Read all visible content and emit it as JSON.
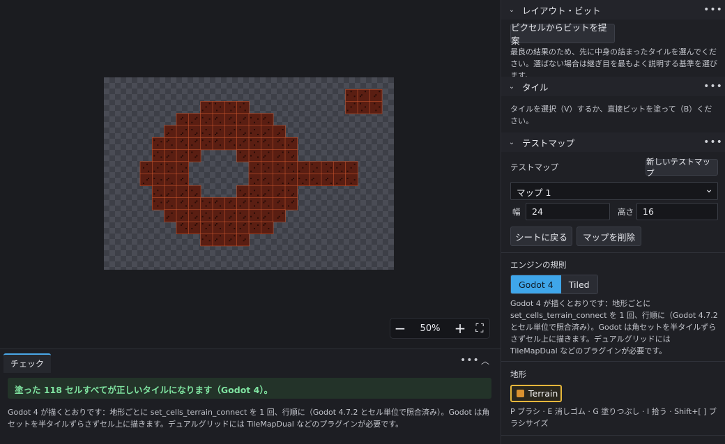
{
  "canvas": {
    "zoom_out_glyph": "−",
    "zoom_level": "50%",
    "zoom_in_glyph": "+",
    "fit_glyph": "⛶",
    "grid": {
      "cols": 24,
      "rows": 16,
      "cells": [
        [
          20,
          1
        ],
        [
          21,
          1
        ],
        [
          22,
          1
        ],
        [
          20,
          2
        ],
        [
          21,
          2
        ],
        [
          22,
          2
        ],
        [
          8,
          2
        ],
        [
          9,
          2
        ],
        [
          10,
          2
        ],
        [
          11,
          2
        ],
        [
          6,
          3
        ],
        [
          7,
          3
        ],
        [
          8,
          3
        ],
        [
          9,
          3
        ],
        [
          10,
          3
        ],
        [
          11,
          3
        ],
        [
          12,
          3
        ],
        [
          13,
          3
        ],
        [
          5,
          4
        ],
        [
          6,
          4
        ],
        [
          7,
          4
        ],
        [
          8,
          4
        ],
        [
          9,
          4
        ],
        [
          10,
          4
        ],
        [
          11,
          4
        ],
        [
          12,
          4
        ],
        [
          13,
          4
        ],
        [
          14,
          4
        ],
        [
          4,
          5
        ],
        [
          5,
          5
        ],
        [
          6,
          5
        ],
        [
          7,
          5
        ],
        [
          8,
          5
        ],
        [
          9,
          5
        ],
        [
          10,
          5
        ],
        [
          11,
          5
        ],
        [
          12,
          5
        ],
        [
          13,
          5
        ],
        [
          14,
          5
        ],
        [
          15,
          5
        ],
        [
          4,
          6
        ],
        [
          5,
          6
        ],
        [
          6,
          6
        ],
        [
          7,
          6
        ],
        [
          11,
          6
        ],
        [
          12,
          6
        ],
        [
          13,
          6
        ],
        [
          14,
          6
        ],
        [
          15,
          6
        ],
        [
          3,
          7
        ],
        [
          4,
          7
        ],
        [
          5,
          7
        ],
        [
          6,
          7
        ],
        [
          12,
          7
        ],
        [
          13,
          7
        ],
        [
          14,
          7
        ],
        [
          15,
          7
        ],
        [
          16,
          7
        ],
        [
          17,
          7
        ],
        [
          18,
          7
        ],
        [
          19,
          7
        ],
        [
          20,
          7
        ],
        [
          3,
          8
        ],
        [
          4,
          8
        ],
        [
          5,
          8
        ],
        [
          6,
          8
        ],
        [
          12,
          8
        ],
        [
          13,
          8
        ],
        [
          14,
          8
        ],
        [
          15,
          8
        ],
        [
          16,
          8
        ],
        [
          17,
          8
        ],
        [
          18,
          8
        ],
        [
          19,
          8
        ],
        [
          20,
          8
        ],
        [
          4,
          9
        ],
        [
          5,
          9
        ],
        [
          6,
          9
        ],
        [
          7,
          9
        ],
        [
          11,
          9
        ],
        [
          12,
          9
        ],
        [
          13,
          9
        ],
        [
          14,
          9
        ],
        [
          15,
          9
        ],
        [
          4,
          10
        ],
        [
          5,
          10
        ],
        [
          6,
          10
        ],
        [
          7,
          10
        ],
        [
          8,
          10
        ],
        [
          9,
          10
        ],
        [
          10,
          10
        ],
        [
          11,
          10
        ],
        [
          12,
          10
        ],
        [
          13,
          10
        ],
        [
          14,
          10
        ],
        [
          15,
          10
        ],
        [
          5,
          11
        ],
        [
          6,
          11
        ],
        [
          7,
          11
        ],
        [
          8,
          11
        ],
        [
          9,
          11
        ],
        [
          10,
          11
        ],
        [
          11,
          11
        ],
        [
          12,
          11
        ],
        [
          13,
          11
        ],
        [
          14,
          11
        ],
        [
          6,
          12
        ],
        [
          7,
          12
        ],
        [
          8,
          12
        ],
        [
          9,
          12
        ],
        [
          10,
          12
        ],
        [
          11,
          12
        ],
        [
          12,
          12
        ],
        [
          13,
          12
        ],
        [
          8,
          13
        ],
        [
          9,
          13
        ],
        [
          10,
          13
        ],
        [
          11,
          13
        ]
      ]
    },
    "tile_color": "#5a1e12",
    "tile_edge_color": "#c0502a"
  },
  "check": {
    "tab_label": "チェック",
    "menu_glyph": "•••",
    "collapse_glyph": "︿",
    "success": "塗った 118 セルすべてが正しいタイルになります（Godot 4）。",
    "detail": "Godot 4 が描くとおりです：地形ごとに set_cells_terrain_connect を 1 回、行順に（Godot 4.7.2 とセル単位で照合済み）。Godot は角セットを半タイルずらさずセル上に描きます。デュアルグリッドには TileMapDual などのプラグインが必要です。"
  },
  "sidebar": {
    "layout_bits": {
      "title": "レイアウト・ビット",
      "suggest_button": "ピクセルからビットを提案",
      "note": "最良の結果のため、先に中身の詰まったタイルを選んでください。選ばない場合は継ぎ目を最もよく説明する基準を選びます。"
    },
    "tiles": {
      "title": "タイル",
      "note": "タイルを選択（V）するか、直接ビットを塗って（B）ください。"
    },
    "test_map": {
      "title": "テストマップ",
      "label": "テストマップ",
      "new_button": "新しいテストマップ",
      "selected_map": "マップ 1",
      "width_label": "幅",
      "width_value": "24",
      "height_label": "高さ",
      "height_value": "16",
      "back_button": "シートに戻る",
      "delete_button": "マップを削除"
    },
    "engine": {
      "label": "エンジンの規則",
      "options": [
        "Godot 4",
        "Tiled"
      ],
      "note": "Godot 4 が描くとおりです：地形ごとに set_cells_terrain_connect を 1 回、行順に（Godot 4.7.2 とセル単位で照合済み）。Godot は角セットを半タイルずらさずセル上に描きます。デュアルグリッドには TileMapDual などのプラグインが必要です。"
    },
    "terrain": {
      "label": "地形",
      "chip": "Terrain",
      "chip_color": "#d9912f",
      "shortcuts": "P ブラシ · E 消しゴム · G 塗りつぶし · I 拾う · Shift+[ ] ブラシサイズ"
    },
    "chevron_glyph": "⌄",
    "dots_glyph": "•••"
  }
}
